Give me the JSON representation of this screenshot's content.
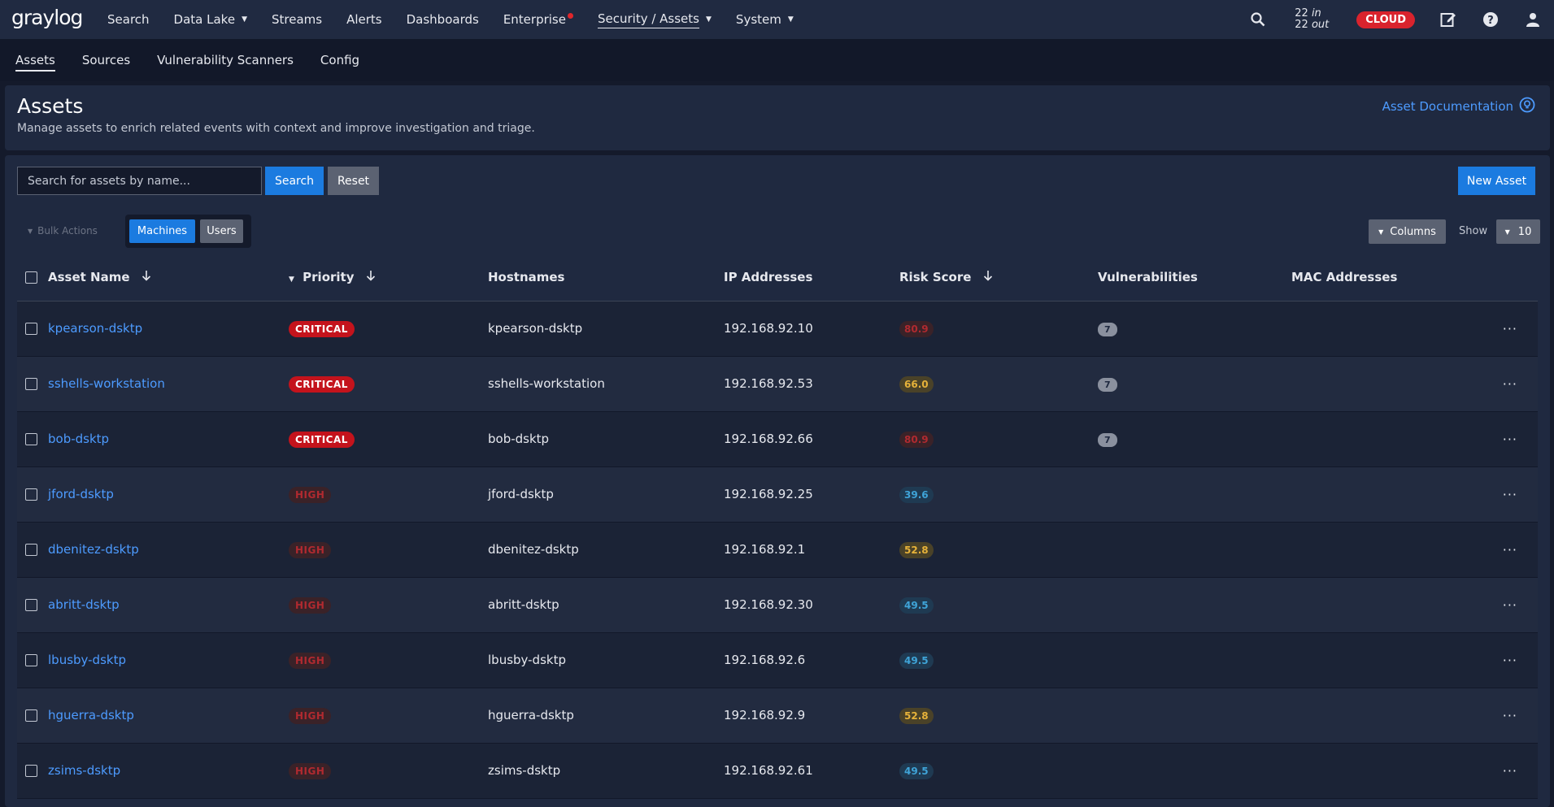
{
  "topnav": {
    "logo": "graylog",
    "items": [
      {
        "label": "Search",
        "caret": false
      },
      {
        "label": "Data Lake",
        "caret": true
      },
      {
        "label": "Streams",
        "caret": false
      },
      {
        "label": "Alerts",
        "caret": false
      },
      {
        "label": "Dashboards",
        "caret": false
      },
      {
        "label": "Enterprise",
        "caret": false
      },
      {
        "label": "Security / Assets",
        "caret": true
      },
      {
        "label": "System",
        "caret": true
      }
    ],
    "throughput_in_count": "22",
    "throughput_in_label": "in",
    "throughput_out_count": "22",
    "throughput_out_label": "out",
    "cloud_badge": "CLOUD"
  },
  "subnav": {
    "items": [
      "Assets",
      "Sources",
      "Vulnerability Scanners",
      "Config"
    ]
  },
  "header": {
    "title": "Assets",
    "description": "Manage assets to enrich related events with context and improve investigation and triage.",
    "doc_link": "Asset Documentation"
  },
  "toolbar": {
    "search_placeholder": "Search for assets by name...",
    "search_label": "Search",
    "reset_label": "Reset",
    "new_asset_label": "New Asset",
    "bulk_actions_label": "Bulk Actions",
    "toggle_machines": "Machines",
    "toggle_users": "Users",
    "columns_label": "Columns",
    "show_label": "Show",
    "page_size": "10"
  },
  "table": {
    "headers": {
      "asset_name": "Asset Name",
      "priority": "Priority",
      "hostnames": "Hostnames",
      "ip": "IP Addresses",
      "risk": "Risk Score",
      "vulns": "Vulnerabilities",
      "mac": "MAC Addresses"
    },
    "rows": [
      {
        "name": "kpearson-dsktp",
        "priority": "CRITICAL",
        "hostname": "kpearson-dsktp",
        "ip": "192.168.92.10",
        "risk": "80.9",
        "vulns": "7"
      },
      {
        "name": "sshells-workstation",
        "priority": "CRITICAL",
        "hostname": "sshells-workstation",
        "ip": "192.168.92.53",
        "risk": "66.0",
        "vulns": "7"
      },
      {
        "name": "bob-dsktp",
        "priority": "CRITICAL",
        "hostname": "bob-dsktp",
        "ip": "192.168.92.66",
        "risk": "80.9",
        "vulns": "7"
      },
      {
        "name": "jford-dsktp",
        "priority": "HIGH",
        "hostname": "jford-dsktp",
        "ip": "192.168.92.25",
        "risk": "39.6",
        "vulns": ""
      },
      {
        "name": "dbenitez-dsktp",
        "priority": "HIGH",
        "hostname": "dbenitez-dsktp",
        "ip": "192.168.92.1",
        "risk": "52.8",
        "vulns": ""
      },
      {
        "name": "abritt-dsktp",
        "priority": "HIGH",
        "hostname": "abritt-dsktp",
        "ip": "192.168.92.30",
        "risk": "49.5",
        "vulns": ""
      },
      {
        "name": "lbusby-dsktp",
        "priority": "HIGH",
        "hostname": "lbusby-dsktp",
        "ip": "192.168.92.6",
        "risk": "49.5",
        "vulns": ""
      },
      {
        "name": "hguerra-dsktp",
        "priority": "HIGH",
        "hostname": "hguerra-dsktp",
        "ip": "192.168.92.9",
        "risk": "52.8",
        "vulns": ""
      },
      {
        "name": "zsims-dsktp",
        "priority": "HIGH",
        "hostname": "zsims-dsktp",
        "ip": "192.168.92.61",
        "risk": "49.5",
        "vulns": ""
      }
    ],
    "row_menu": "···"
  },
  "colors": {
    "accent": "#1b7be0",
    "critical": "#c4131c",
    "risk_red": "#b02a30",
    "risk_yellow": "#e6b23a",
    "risk_blue": "#3fa4d8"
  }
}
